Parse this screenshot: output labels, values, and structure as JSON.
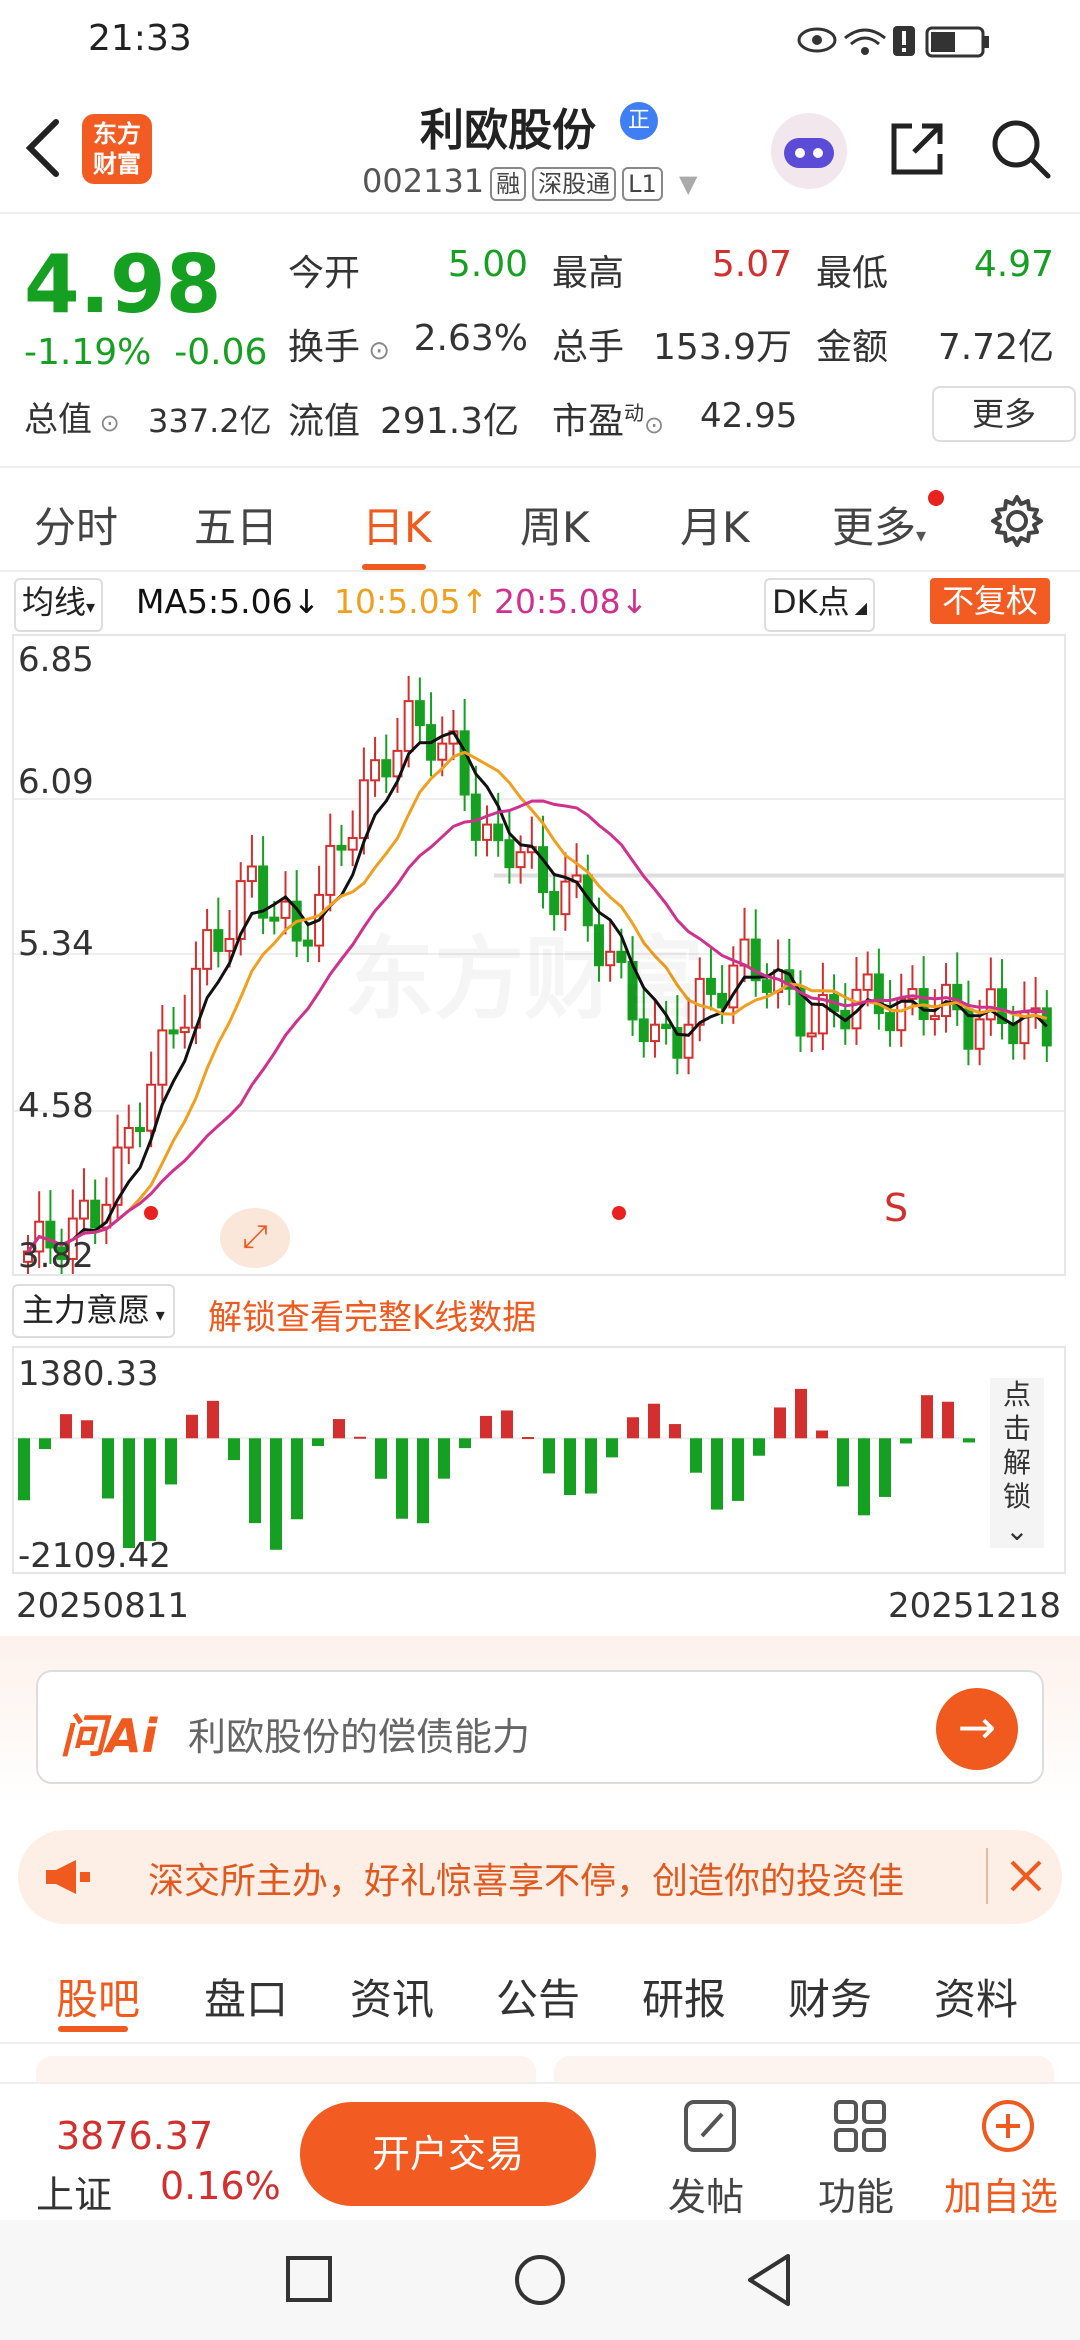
{
  "status": {
    "time": "21:33"
  },
  "header": {
    "logo_line1": "东方",
    "logo_line2": "财富",
    "title": "利欧股份",
    "title_badge": "正",
    "code": "002131",
    "tags": [
      "融",
      "深股通",
      "L1"
    ]
  },
  "quote": {
    "price": "4.98",
    "change_pct": "-1.19%",
    "change": "-0.06",
    "open_label": "今开",
    "open": "5.00",
    "high_label": "最高",
    "high": "5.07",
    "low_label": "最低",
    "low": "4.97",
    "turnover_label": "换手",
    "turnover": "2.63%",
    "volume_label": "总手",
    "volume": "153.9万",
    "amount_label": "金额",
    "amount": "7.72亿",
    "mktcap_label": "总值",
    "mktcap": "337.2亿",
    "float_label": "流值",
    "float": "291.3亿",
    "pe_label": "市盈",
    "pe_sup": "动",
    "pe": "42.95",
    "more": "更多"
  },
  "tabs": [
    "分时",
    "五日",
    "日K",
    "周K",
    "月K",
    "更多"
  ],
  "active_tab": "日K",
  "ma": {
    "selector": "均线",
    "ma5": "MA5:5.06↓",
    "ma10": "10:5.05↑",
    "ma20": "20:5.08↓",
    "dk": "DK点",
    "adjust": "不复权"
  },
  "chart": {
    "y_labels": [
      "6.85",
      "6.09",
      "5.34",
      "4.58",
      "3.82"
    ],
    "signal_s": "S",
    "indicator": "主力意愿",
    "unlock_text": "解锁查看完整K线数据",
    "vol_top": "1380.33",
    "vol_bottom": "-2109.42",
    "side_unlock": "点击解锁",
    "date_start": "20250811",
    "date_end": "20251218",
    "watermark": "东方财富"
  },
  "chart_data": {
    "type": "candlestick",
    "ylim": [
      3.82,
      6.85
    ],
    "x_range": [
      "20250811",
      "20251218"
    ],
    "ma_current": {
      "MA5": 5.06,
      "MA10": 5.05,
      "MA20": 5.08
    },
    "flow_range": [
      -2109.42,
      1380.33
    ]
  },
  "ask": {
    "brand": "问Ai",
    "placeholder": "利欧股份的偿债能力"
  },
  "notice": {
    "text": "深交所主办，好礼惊喜享不停，创造你的投资佳"
  },
  "bottom_tabs": [
    "股吧",
    "盘口",
    "资讯",
    "公告",
    "研报",
    "财务",
    "资料"
  ],
  "footer": {
    "index_value": "3876.37",
    "index_name": "上证",
    "index_pct": "0.16%",
    "trade_btn": "开户交易",
    "post": "发帖",
    "func": "功能",
    "add": "加自选"
  },
  "colors": {
    "up": "#d32f2f",
    "down": "#16a021",
    "accent": "#f05a1e",
    "ma5": "#111111",
    "ma10": "#f0a020",
    "ma20": "#d0318e"
  }
}
